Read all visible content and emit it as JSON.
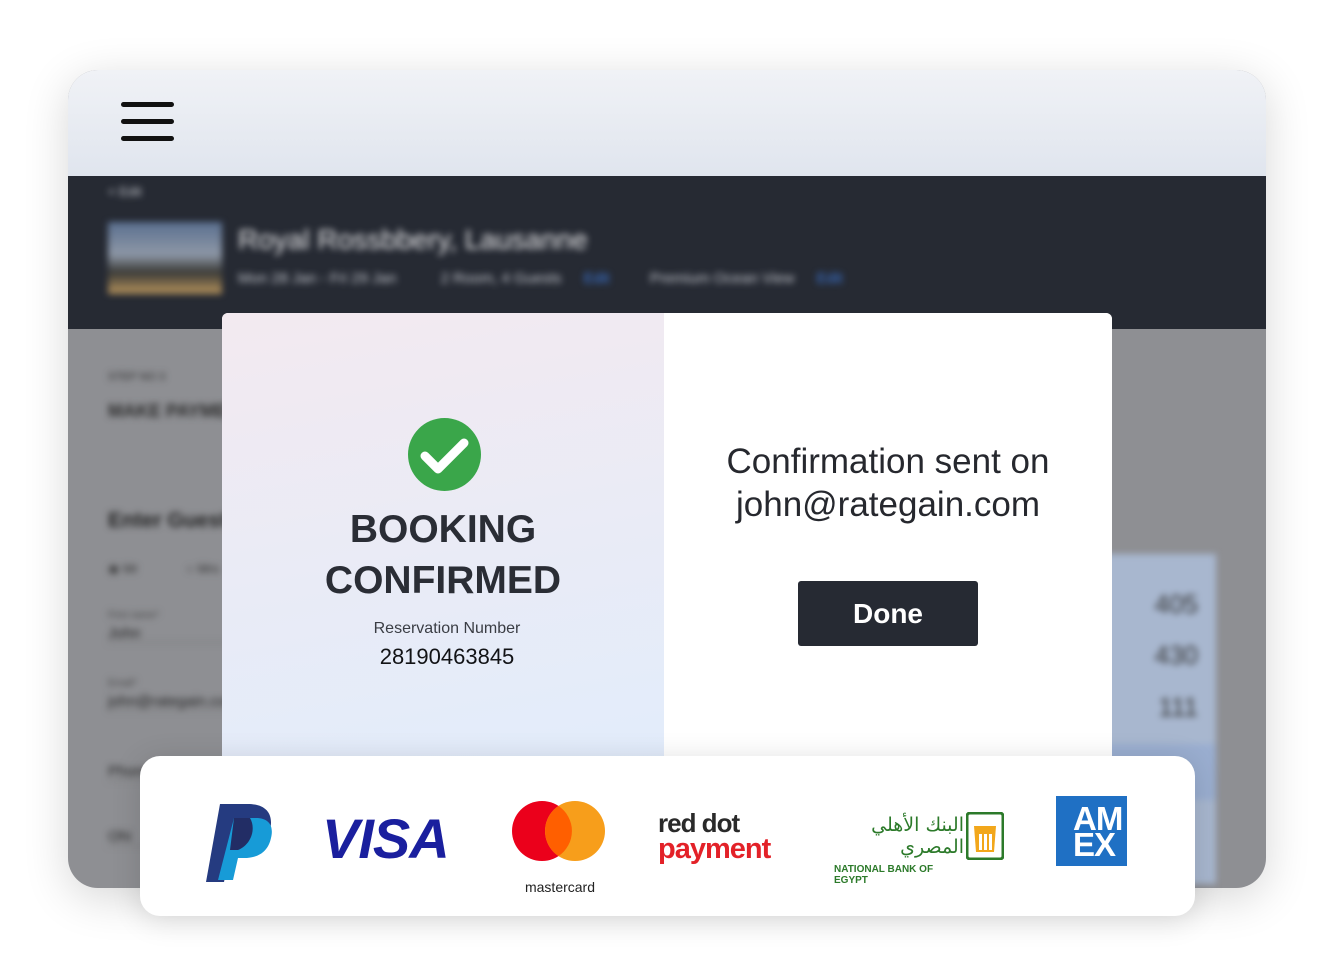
{
  "header": {
    "back_link": "< Edit",
    "hotel_name": "Royal Rossbbery, Lausanne",
    "dates": "Mon 28 Jan - Fri 29 Jan",
    "guests": "2 Room, 4 Guests",
    "guests_action": "Edit",
    "room_type": "Premium Ocean View",
    "room_action": "Edit"
  },
  "background_form": {
    "step": "STEP NO 3",
    "title": "MAKE PAYMENT",
    "enter_guest": "Enter Guest Details",
    "radio_1": "Mr",
    "radio_2": "Mrs",
    "first_name_label": "First name*",
    "first_name_value": "John",
    "email_label": "Email*",
    "email_value": "john@rategain.com",
    "phone_value": "Phone",
    "country_value": "Ohi",
    "summary_lines": [
      "405",
      "430",
      "111"
    ]
  },
  "modal": {
    "status_line1": "BOOKING",
    "status_line2": "CONFIRMED",
    "reservation_label": "Reservation Number",
    "reservation_number": "28190463845",
    "confirmation_line1": "Confirmation sent on",
    "confirmation_email": "john@rategain.com",
    "done_label": "Done",
    "accent": "#3aa64a"
  },
  "payments": {
    "visa": "VISA",
    "mastercard": "mastercard",
    "reddot_line1": "red dot",
    "reddot_line2": "payment",
    "nbe_arabic": "البنك الأهلي المصري",
    "nbe_english": "NATIONAL BANK OF EGYPT",
    "amex_line1": "AM",
    "amex_line2": "EX"
  },
  "colors": {
    "dark": "#262a33",
    "visa_blue": "#1a1f9e",
    "reddot_red": "#e32128",
    "nbe_green": "#2c7a2a",
    "amex_blue": "#1f70c4"
  }
}
